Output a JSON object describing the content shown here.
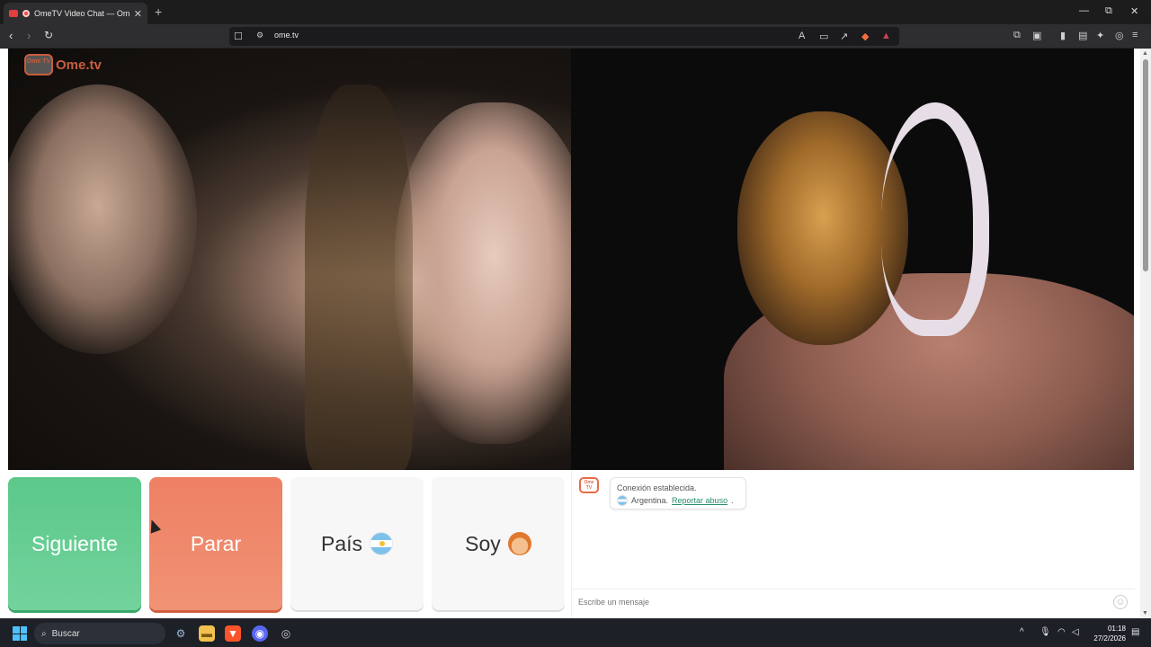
{
  "browser": {
    "tab_title": "OmeTV Video Chat — Omeg",
    "tab_close": "✕",
    "new_tab": "+",
    "url": "ome.tv",
    "window_controls": {
      "minimize": "—",
      "maximize": "⧉",
      "close": "✕"
    }
  },
  "logo": {
    "small": "Ome TV",
    "name": "Ome.tv",
    "brand_color": "#e96b48"
  },
  "buttons": {
    "next": "Siguiente",
    "stop": "Parar",
    "country": "País",
    "gender": "Soy"
  },
  "colors": {
    "next": "#5bc88a",
    "stop": "#ee8064"
  },
  "chat": {
    "status": "Conexión establecida.",
    "country": "Argentina.",
    "report": "Reportar abuso",
    "placeholder": "Escribe un mensaje"
  },
  "taskbar": {
    "search": "Buscar",
    "time": "01:18",
    "date": "27/2/2026"
  }
}
